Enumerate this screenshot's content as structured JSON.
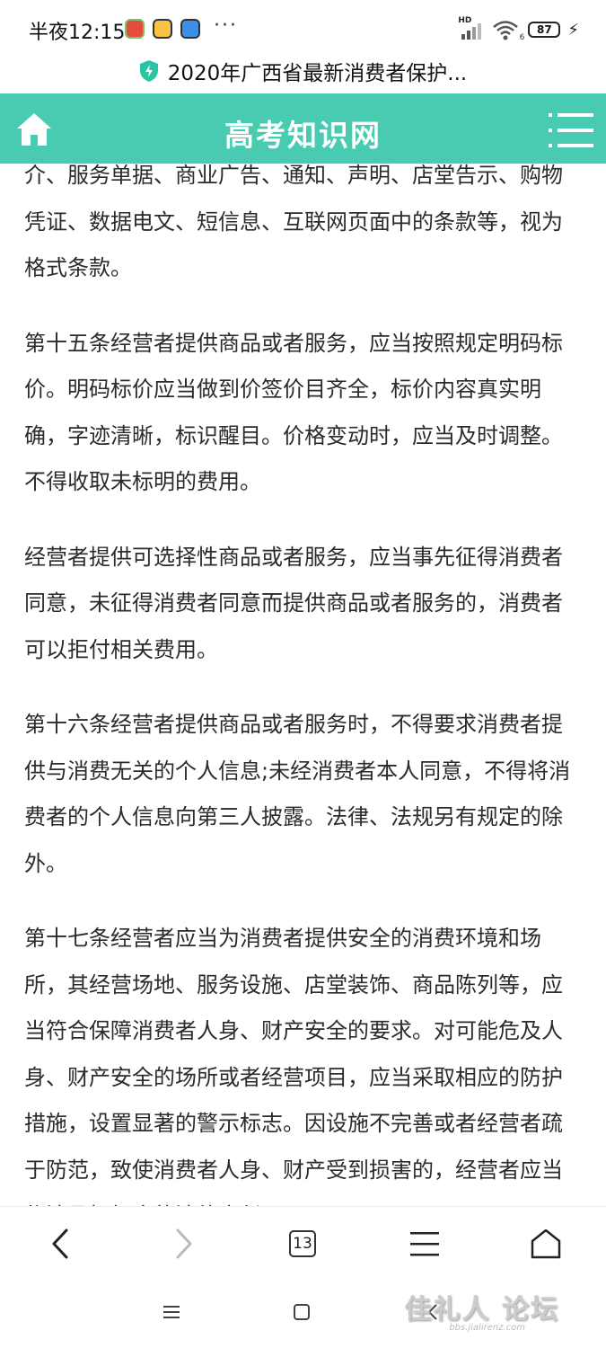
{
  "status_bar": {
    "time": "半夜12:15",
    "dots": "···",
    "battery": "87",
    "network": "HD",
    "wifi_sub": "6"
  },
  "browser": {
    "page_title": "2020年广西省最新消费者保护..."
  },
  "site": {
    "title": "高考知识网",
    "accent_color": "#49cbb2"
  },
  "article": {
    "paragraphs": [
      "介、服务单据、商业广告、通知、声明、店堂告示、购物凭证、数据电文、短信息、互联网页面中的条款等，视为格式条款。",
      "第十五条经营者提供商品或者服务，应当按照规定明码标价。明码标价应当做到价签价目齐全，标价内容真实明确，字迹清晰，标识醒目。价格变动时，应当及时调整。不得收取未标明的费用。",
      "经营者提供可选择性商品或者服务，应当事先征得消费者同意，未征得消费者同意而提供商品或者服务的，消费者可以拒付相关费用。",
      "第十六条经营者提供商品或者服务时，不得要求消费者提供与消费无关的个人信息;未经消费者本人同意，不得将消费者的个人信息向第三人披露。法律、法规另有规定的除外。",
      "第十七条经营者应当为消费者提供安全的消费环境和场所，其经营场地、服务设施、店堂装饰、商品陈列等，应当符合保障消费者人身、财产安全的要求。对可能危及人身、财产安全的场所或者经营项目，应当采取相应的防护措施，设置显著的警示标志。因设施不完善或者经营者疏于防范，致使消费者人身、财产受到损害的，经营者应当依法承担相应的法律责任。"
    ]
  },
  "bottom_nav": {
    "tab_count": "13"
  },
  "watermark": {
    "text": "佳礼人 论坛",
    "sub": "bbs.jialirenz.com"
  }
}
